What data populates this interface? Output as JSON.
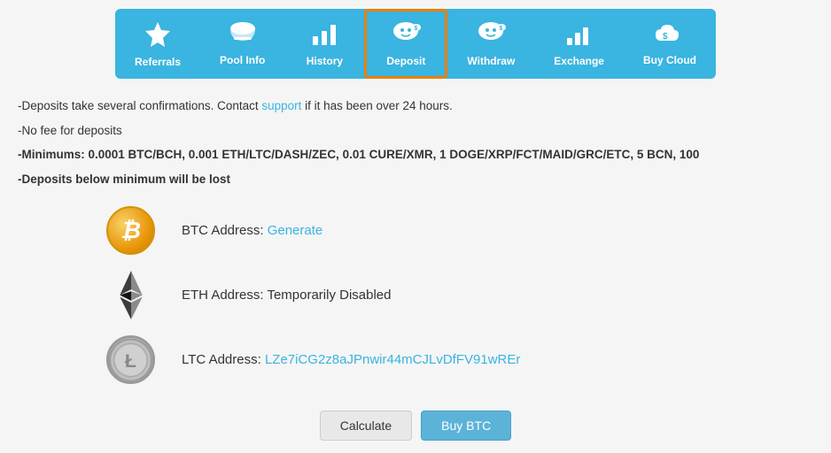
{
  "nav": {
    "items": [
      {
        "id": "referrals",
        "label": "Referrals",
        "icon": "⭐",
        "active": false
      },
      {
        "id": "pool-info",
        "label": "Pool Info",
        "icon": "☁",
        "active": false
      },
      {
        "id": "history",
        "label": "History",
        "icon": "📊",
        "active": false
      },
      {
        "id": "deposit",
        "label": "Deposit",
        "icon": "🐷",
        "active": true
      },
      {
        "id": "withdraw",
        "label": "Withdraw",
        "icon": "🐷",
        "active": false
      },
      {
        "id": "exchange",
        "label": "Exchange",
        "icon": "📊",
        "active": false
      },
      {
        "id": "buy-cloud",
        "label": "Buy Cloud",
        "icon": "☁",
        "active": false
      }
    ]
  },
  "info": {
    "line1_prefix": "-Deposits take several confirmations. Contact ",
    "line1_link": "support",
    "line1_suffix": " if it has been over 24 hours.",
    "line2": "-No fee for deposits",
    "line3": "-Minimums: 0.0001 BTC/BCH, 0.001 ETH/LTC/DASH/ZEC, 0.01 CURE/XMR, 1 DOGE/XRP/FCT/MAID/GRC/ETC, 5 BCN, 100",
    "line4": "-Deposits below minimum will be lost"
  },
  "coins": [
    {
      "id": "btc",
      "label": "BTC Address: ",
      "value": "Generate",
      "value_is_link": true,
      "type": "btc"
    },
    {
      "id": "eth",
      "label": "ETH Address: ",
      "value": "Temporarily Disabled",
      "value_is_link": false,
      "type": "eth"
    },
    {
      "id": "ltc",
      "label": "LTC Address: ",
      "value": "LZe7iCG2z8aJPnwir44mCJLvDfFV91wREr",
      "value_is_link": true,
      "type": "ltc"
    }
  ],
  "buttons": {
    "calculate": "Calculate",
    "buy_btc": "Buy BTC"
  }
}
